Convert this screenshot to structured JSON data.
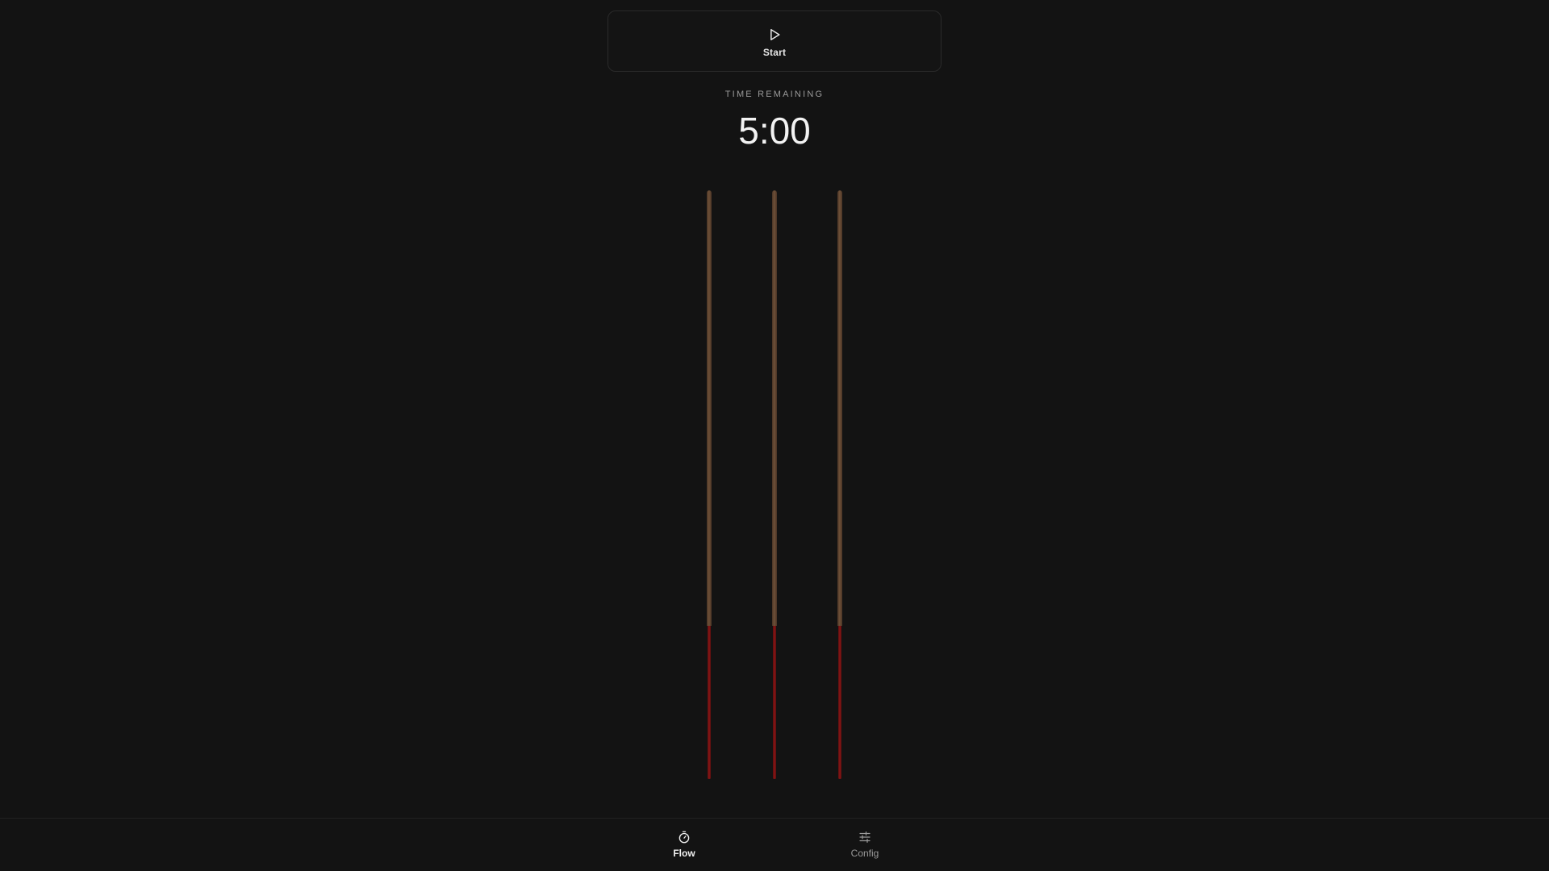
{
  "controls": {
    "start_label": "Start",
    "start_icon": "play-icon"
  },
  "timer": {
    "caption": "TIME REMAINING",
    "value": "5:00"
  },
  "incense_sticks": [
    {
      "remaining_fraction": 1.0
    },
    {
      "remaining_fraction": 1.0
    },
    {
      "remaining_fraction": 1.0
    }
  ],
  "nav": {
    "items": [
      {
        "label": "Flow",
        "icon": "stopwatch-icon",
        "active": true
      },
      {
        "label": "Config",
        "icon": "sliders-icon",
        "active": false
      }
    ]
  },
  "colors": {
    "background": "#131313",
    "stick_body": "#6e5038",
    "stick_core": "#8a1616",
    "text_primary": "#f2f2f2",
    "text_muted": "#9a9a9a"
  }
}
